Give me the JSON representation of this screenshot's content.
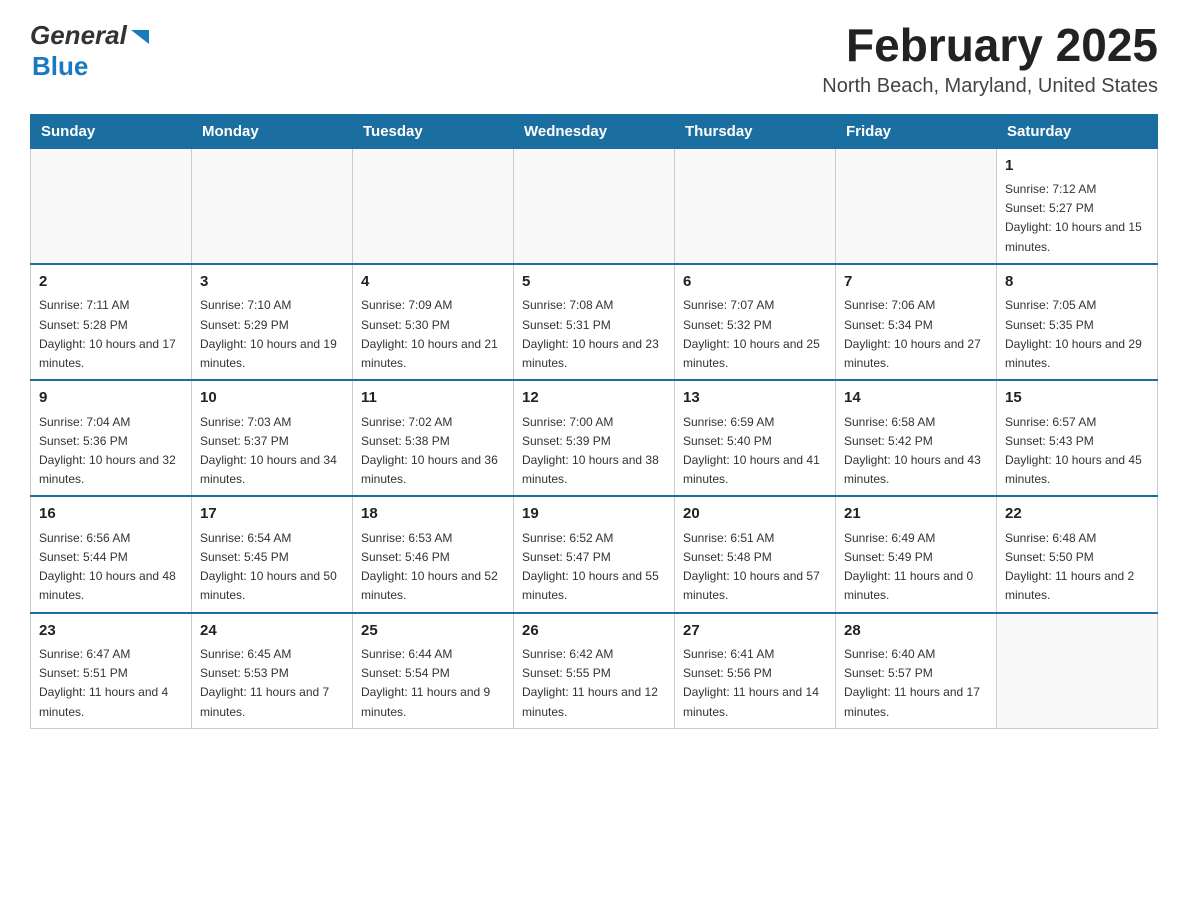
{
  "header": {
    "logo_general": "General",
    "logo_blue": "Blue",
    "month_title": "February 2025",
    "location": "North Beach, Maryland, United States"
  },
  "days_of_week": [
    "Sunday",
    "Monday",
    "Tuesday",
    "Wednesday",
    "Thursday",
    "Friday",
    "Saturday"
  ],
  "weeks": [
    {
      "days": [
        {
          "number": "",
          "sunrise": "",
          "sunset": "",
          "daylight": "",
          "empty": true
        },
        {
          "number": "",
          "sunrise": "",
          "sunset": "",
          "daylight": "",
          "empty": true
        },
        {
          "number": "",
          "sunrise": "",
          "sunset": "",
          "daylight": "",
          "empty": true
        },
        {
          "number": "",
          "sunrise": "",
          "sunset": "",
          "daylight": "",
          "empty": true
        },
        {
          "number": "",
          "sunrise": "",
          "sunset": "",
          "daylight": "",
          "empty": true
        },
        {
          "number": "",
          "sunrise": "",
          "sunset": "",
          "daylight": "",
          "empty": true
        },
        {
          "number": "1",
          "sunrise": "Sunrise: 7:12 AM",
          "sunset": "Sunset: 5:27 PM",
          "daylight": "Daylight: 10 hours and 15 minutes.",
          "empty": false
        }
      ]
    },
    {
      "days": [
        {
          "number": "2",
          "sunrise": "Sunrise: 7:11 AM",
          "sunset": "Sunset: 5:28 PM",
          "daylight": "Daylight: 10 hours and 17 minutes.",
          "empty": false
        },
        {
          "number": "3",
          "sunrise": "Sunrise: 7:10 AM",
          "sunset": "Sunset: 5:29 PM",
          "daylight": "Daylight: 10 hours and 19 minutes.",
          "empty": false
        },
        {
          "number": "4",
          "sunrise": "Sunrise: 7:09 AM",
          "sunset": "Sunset: 5:30 PM",
          "daylight": "Daylight: 10 hours and 21 minutes.",
          "empty": false
        },
        {
          "number": "5",
          "sunrise": "Sunrise: 7:08 AM",
          "sunset": "Sunset: 5:31 PM",
          "daylight": "Daylight: 10 hours and 23 minutes.",
          "empty": false
        },
        {
          "number": "6",
          "sunrise": "Sunrise: 7:07 AM",
          "sunset": "Sunset: 5:32 PM",
          "daylight": "Daylight: 10 hours and 25 minutes.",
          "empty": false
        },
        {
          "number": "7",
          "sunrise": "Sunrise: 7:06 AM",
          "sunset": "Sunset: 5:34 PM",
          "daylight": "Daylight: 10 hours and 27 minutes.",
          "empty": false
        },
        {
          "number": "8",
          "sunrise": "Sunrise: 7:05 AM",
          "sunset": "Sunset: 5:35 PM",
          "daylight": "Daylight: 10 hours and 29 minutes.",
          "empty": false
        }
      ]
    },
    {
      "days": [
        {
          "number": "9",
          "sunrise": "Sunrise: 7:04 AM",
          "sunset": "Sunset: 5:36 PM",
          "daylight": "Daylight: 10 hours and 32 minutes.",
          "empty": false
        },
        {
          "number": "10",
          "sunrise": "Sunrise: 7:03 AM",
          "sunset": "Sunset: 5:37 PM",
          "daylight": "Daylight: 10 hours and 34 minutes.",
          "empty": false
        },
        {
          "number": "11",
          "sunrise": "Sunrise: 7:02 AM",
          "sunset": "Sunset: 5:38 PM",
          "daylight": "Daylight: 10 hours and 36 minutes.",
          "empty": false
        },
        {
          "number": "12",
          "sunrise": "Sunrise: 7:00 AM",
          "sunset": "Sunset: 5:39 PM",
          "daylight": "Daylight: 10 hours and 38 minutes.",
          "empty": false
        },
        {
          "number": "13",
          "sunrise": "Sunrise: 6:59 AM",
          "sunset": "Sunset: 5:40 PM",
          "daylight": "Daylight: 10 hours and 41 minutes.",
          "empty": false
        },
        {
          "number": "14",
          "sunrise": "Sunrise: 6:58 AM",
          "sunset": "Sunset: 5:42 PM",
          "daylight": "Daylight: 10 hours and 43 minutes.",
          "empty": false
        },
        {
          "number": "15",
          "sunrise": "Sunrise: 6:57 AM",
          "sunset": "Sunset: 5:43 PM",
          "daylight": "Daylight: 10 hours and 45 minutes.",
          "empty": false
        }
      ]
    },
    {
      "days": [
        {
          "number": "16",
          "sunrise": "Sunrise: 6:56 AM",
          "sunset": "Sunset: 5:44 PM",
          "daylight": "Daylight: 10 hours and 48 minutes.",
          "empty": false
        },
        {
          "number": "17",
          "sunrise": "Sunrise: 6:54 AM",
          "sunset": "Sunset: 5:45 PM",
          "daylight": "Daylight: 10 hours and 50 minutes.",
          "empty": false
        },
        {
          "number": "18",
          "sunrise": "Sunrise: 6:53 AM",
          "sunset": "Sunset: 5:46 PM",
          "daylight": "Daylight: 10 hours and 52 minutes.",
          "empty": false
        },
        {
          "number": "19",
          "sunrise": "Sunrise: 6:52 AM",
          "sunset": "Sunset: 5:47 PM",
          "daylight": "Daylight: 10 hours and 55 minutes.",
          "empty": false
        },
        {
          "number": "20",
          "sunrise": "Sunrise: 6:51 AM",
          "sunset": "Sunset: 5:48 PM",
          "daylight": "Daylight: 10 hours and 57 minutes.",
          "empty": false
        },
        {
          "number": "21",
          "sunrise": "Sunrise: 6:49 AM",
          "sunset": "Sunset: 5:49 PM",
          "daylight": "Daylight: 11 hours and 0 minutes.",
          "empty": false
        },
        {
          "number": "22",
          "sunrise": "Sunrise: 6:48 AM",
          "sunset": "Sunset: 5:50 PM",
          "daylight": "Daylight: 11 hours and 2 minutes.",
          "empty": false
        }
      ]
    },
    {
      "days": [
        {
          "number": "23",
          "sunrise": "Sunrise: 6:47 AM",
          "sunset": "Sunset: 5:51 PM",
          "daylight": "Daylight: 11 hours and 4 minutes.",
          "empty": false
        },
        {
          "number": "24",
          "sunrise": "Sunrise: 6:45 AM",
          "sunset": "Sunset: 5:53 PM",
          "daylight": "Daylight: 11 hours and 7 minutes.",
          "empty": false
        },
        {
          "number": "25",
          "sunrise": "Sunrise: 6:44 AM",
          "sunset": "Sunset: 5:54 PM",
          "daylight": "Daylight: 11 hours and 9 minutes.",
          "empty": false
        },
        {
          "number": "26",
          "sunrise": "Sunrise: 6:42 AM",
          "sunset": "Sunset: 5:55 PM",
          "daylight": "Daylight: 11 hours and 12 minutes.",
          "empty": false
        },
        {
          "number": "27",
          "sunrise": "Sunrise: 6:41 AM",
          "sunset": "Sunset: 5:56 PM",
          "daylight": "Daylight: 11 hours and 14 minutes.",
          "empty": false
        },
        {
          "number": "28",
          "sunrise": "Sunrise: 6:40 AM",
          "sunset": "Sunset: 5:57 PM",
          "daylight": "Daylight: 11 hours and 17 minutes.",
          "empty": false
        },
        {
          "number": "",
          "sunrise": "",
          "sunset": "",
          "daylight": "",
          "empty": true
        }
      ]
    }
  ]
}
